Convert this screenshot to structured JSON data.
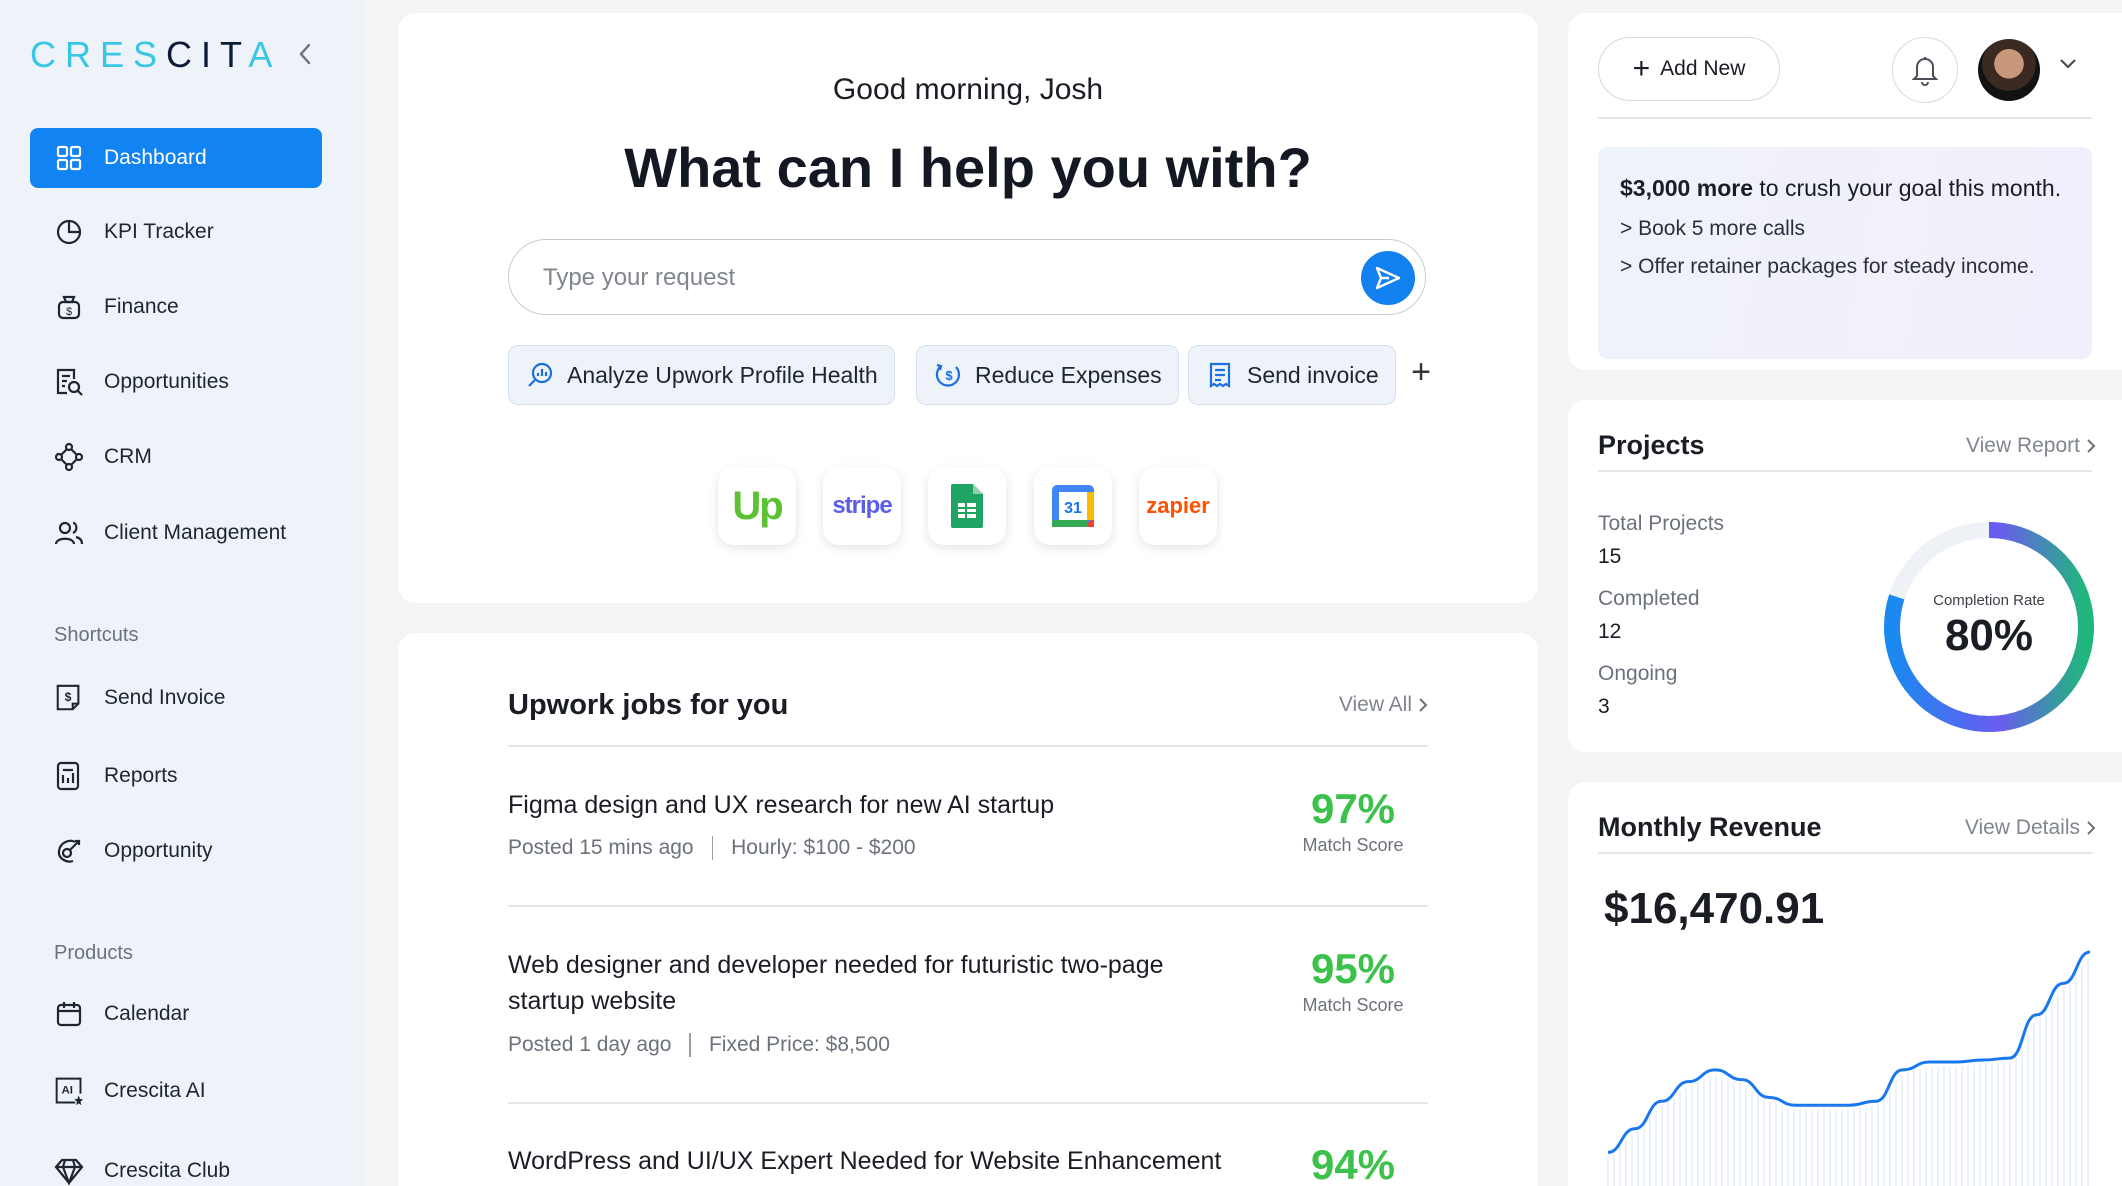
{
  "brand": {
    "name": "CRESCITA"
  },
  "sidebar": {
    "main_items": [
      {
        "label": "Dashboard",
        "icon": "grid-icon",
        "active": true
      },
      {
        "label": "KPI Tracker",
        "icon": "pie-chart-icon"
      },
      {
        "label": "Finance",
        "icon": "money-bag-icon"
      },
      {
        "label": "Opportunities",
        "icon": "document-search-icon"
      },
      {
        "label": "CRM",
        "icon": "network-icon"
      },
      {
        "label": "Client Management",
        "icon": "users-icon"
      }
    ],
    "shortcuts_label": "Shortcuts",
    "shortcuts": [
      {
        "label": "Send Invoice",
        "icon": "invoice-dollar-icon"
      },
      {
        "label": "Reports",
        "icon": "report-icon"
      },
      {
        "label": "Opportunity",
        "icon": "target-icon"
      }
    ],
    "products_label": "Products",
    "products": [
      {
        "label": "Calendar",
        "icon": "calendar-icon"
      },
      {
        "label": "Crescita AI",
        "icon": "ai-icon"
      },
      {
        "label": "Crescita Club",
        "icon": "diamond-icon"
      }
    ]
  },
  "hero": {
    "greeting": "Good morning, Josh",
    "headline": "What can I help you with?",
    "search_placeholder": "Type your request",
    "chips": [
      {
        "label": "Analyze Upwork Profile Health",
        "icon": "search-analytics-icon"
      },
      {
        "label": "Reduce Expenses",
        "icon": "reduce-dollar-icon"
      },
      {
        "label": "Send invoice",
        "icon": "receipt-icon"
      }
    ],
    "integrations": [
      "Upwork",
      "stripe",
      "Google Sheets",
      "Google Calendar",
      "zapier"
    ],
    "calendar_day": "31",
    "upwork_text": "Up",
    "stripe_text": "stripe",
    "zapier_text": "zapier"
  },
  "jobs": {
    "title": "Upwork jobs for you",
    "view_all": "View All",
    "match_label": "Match Score",
    "items": [
      {
        "title": "Figma design and UX research for new AI startup",
        "posted": "Posted 15 mins ago",
        "pay": "Hourly: $100 - $200",
        "score": "97%"
      },
      {
        "title": "Web designer and developer needed for futuristic two-page startup website",
        "posted": "Posted 1 day ago",
        "pay": "Fixed Price: $8,500",
        "score": "95%"
      },
      {
        "title": "WordPress and UI/UX Expert Needed for Website Enhancement",
        "posted": "",
        "pay": "",
        "score": "94%"
      }
    ]
  },
  "topbar": {
    "add_new": "Add New",
    "goal_bold": "$3,000 more",
    "goal_rest": " to crush your goal this month.",
    "tips": [
      "> Book 5 more calls",
      "> Offer retainer packages for steady income."
    ]
  },
  "projects": {
    "title": "Projects",
    "view_report": "View Report",
    "total_label": "Total Projects",
    "total": "15",
    "completed_label": "Completed",
    "completed": "12",
    "ongoing_label": "Ongoing",
    "ongoing": "3",
    "rate_label": "Completion Rate",
    "rate": "80%",
    "rate_value": 0.8
  },
  "revenue": {
    "title": "Monthly Revenue",
    "view_details": "View Details",
    "amount": "$16,470.91",
    "chart_data": {
      "type": "line",
      "values": [
        10,
        22,
        36,
        46,
        52,
        47,
        38,
        34,
        34,
        34,
        36,
        52,
        56,
        56,
        57,
        58,
        80,
        96,
        112
      ],
      "color": "#1a78ee"
    }
  },
  "colors": {
    "accent": "#1283f2",
    "score_green": "#3cc24a"
  }
}
